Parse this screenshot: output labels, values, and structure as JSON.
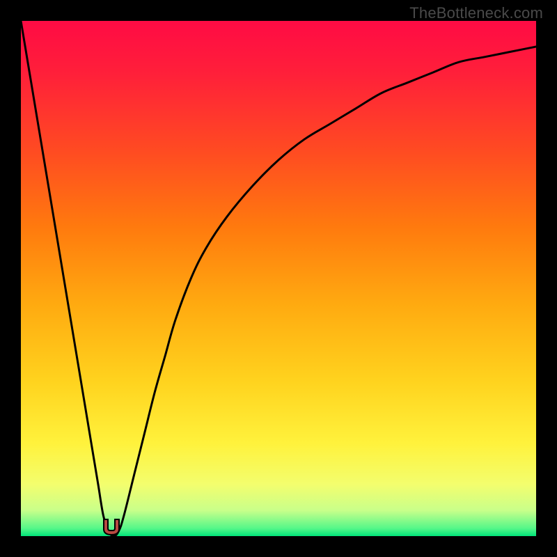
{
  "watermark_text": "TheBottleneck.com",
  "colors": {
    "frame": "#000000",
    "gradient_stops": [
      {
        "offset": 0.0,
        "color": "#ff0b44"
      },
      {
        "offset": 0.1,
        "color": "#ff1f3a"
      },
      {
        "offset": 0.25,
        "color": "#ff4a22"
      },
      {
        "offset": 0.4,
        "color": "#ff7a0e"
      },
      {
        "offset": 0.55,
        "color": "#ffaa10"
      },
      {
        "offset": 0.7,
        "color": "#ffd31e"
      },
      {
        "offset": 0.82,
        "color": "#fff23c"
      },
      {
        "offset": 0.9,
        "color": "#f3fe6e"
      },
      {
        "offset": 0.95,
        "color": "#c9ff8a"
      },
      {
        "offset": 0.985,
        "color": "#55f789"
      },
      {
        "offset": 1.0,
        "color": "#00e47a"
      }
    ],
    "curve_stroke": "#000000",
    "marker_fill": "#b94a42",
    "marker_stroke": "#000000"
  },
  "chart_data": {
    "type": "line",
    "title": "",
    "xlabel": "",
    "ylabel": "",
    "xlim": [
      0,
      100
    ],
    "ylim": [
      0,
      100
    ],
    "x": [
      0,
      2,
      4,
      6,
      8,
      10,
      12,
      14,
      15,
      16,
      17,
      18,
      19,
      20,
      22,
      24,
      26,
      28,
      30,
      33,
      36,
      40,
      45,
      50,
      55,
      60,
      65,
      70,
      75,
      80,
      85,
      90,
      95,
      100
    ],
    "series": [
      {
        "name": "bottleneck-curve",
        "values": [
          100,
          88,
          76,
          64,
          52,
          40,
          28,
          16,
          10,
          4,
          1,
          0,
          1,
          4,
          12,
          20,
          28,
          35,
          42,
          50,
          56,
          62,
          68,
          73,
          77,
          80,
          83,
          86,
          88,
          90,
          92,
          93,
          94,
          95
        ]
      }
    ],
    "minimum_x": 17.5,
    "annotations": []
  },
  "marker": {
    "x_percent": 17.5,
    "glyph": "U"
  }
}
